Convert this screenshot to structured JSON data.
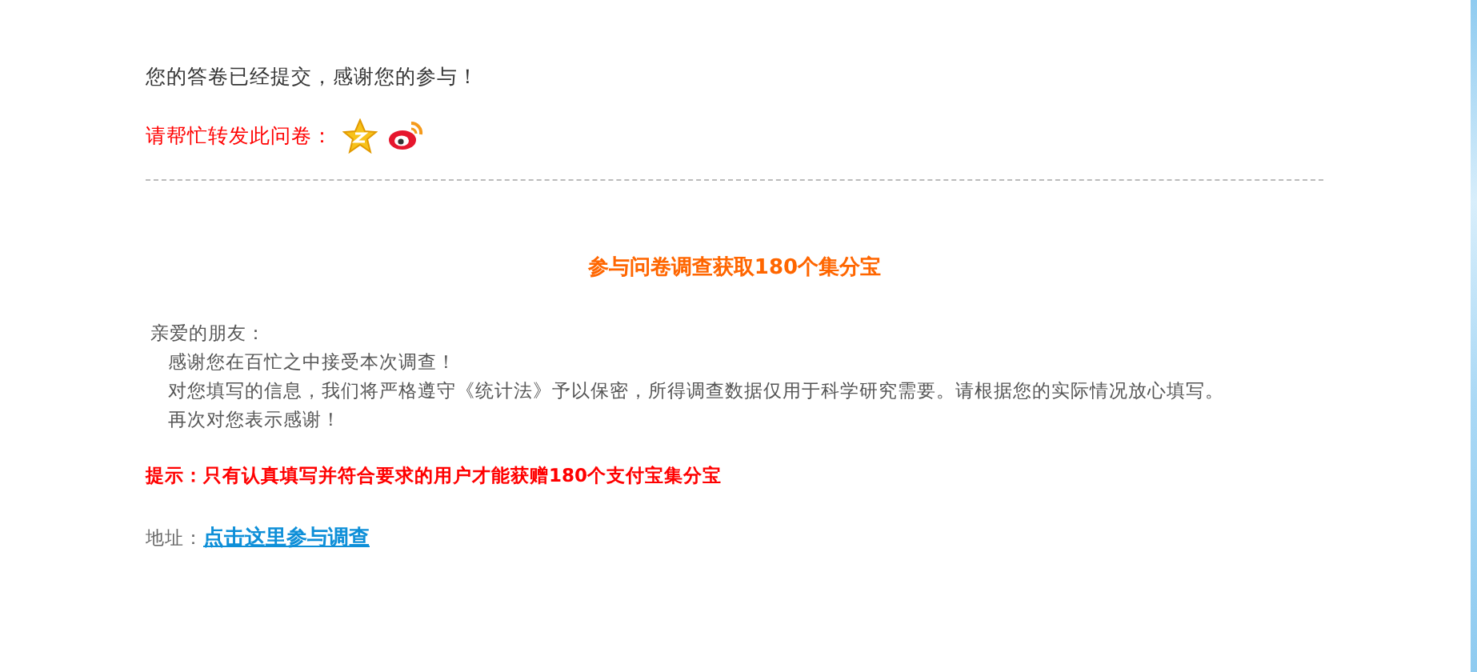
{
  "confirmation": "您的答卷已经提交，感谢您的参与！",
  "share": {
    "label": "请帮忙转发此问卷：",
    "targets": [
      {
        "kind": "qzone"
      },
      {
        "kind": "weibo"
      }
    ]
  },
  "promo": {
    "heading": "参与问卷调查获取180个集分宝",
    "greeting": "亲爱的朋友：",
    "lines": [
      "感谢您在百忙之中接受本次调查！",
      "对您填写的信息，我们将严格遵守《统计法》予以保密，所得调查数据仅用于科学研究需要。请根据您的实际情况放心填写。",
      "再次对您表示感谢！"
    ],
    "tip": "提示：只有认真填写并符合要求的用户才能获赠180个支付宝集分宝",
    "address_label": "地址：",
    "link": "点击这里参与调查"
  }
}
